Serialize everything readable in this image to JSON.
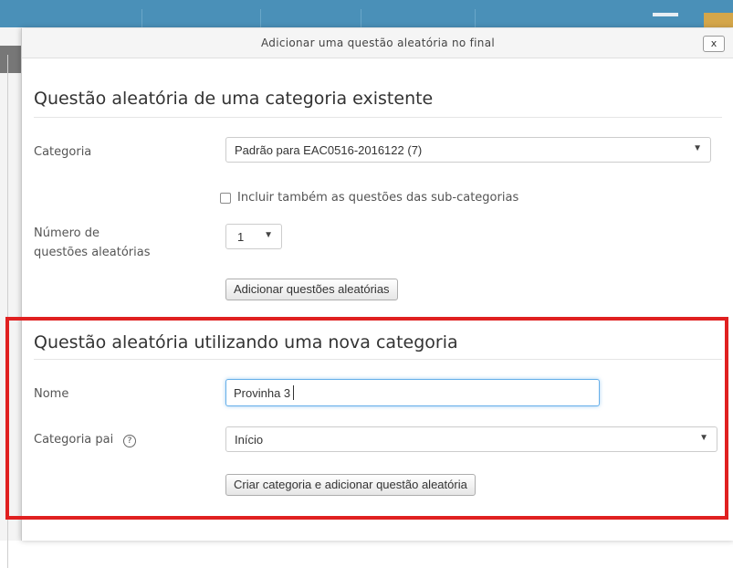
{
  "dialog": {
    "title": "Adicionar uma questão aleatória no final",
    "close_label": "x"
  },
  "existing_section": {
    "heading": "Questão aleatória de uma categoria existente",
    "category_label": "Categoria",
    "category_value": "Padrão para EAC0516-2016122 (7)",
    "include_subcategories_label": "Incluir também as questões das sub-categorias",
    "include_subcategories_checked": false,
    "number_label_line1": "Número de",
    "number_label_line2": "questões aleatórias",
    "number_value": "1",
    "add_button": "Adicionar questões aleatórias"
  },
  "new_section": {
    "heading": "Questão aleatória utilizando uma nova categoria",
    "name_label": "Nome",
    "name_value": "Provinha 3",
    "parent_label": "Categoria pai",
    "parent_value": "Início",
    "create_button": "Criar categoria e adicionar questão aleatória"
  },
  "colors": {
    "highlight": "#e02020",
    "focus_border": "#66afe9",
    "topbar": "#4a90b8"
  },
  "icons": {
    "dropdown": "chevron-down-icon",
    "help": "help-icon",
    "close": "close-icon"
  }
}
